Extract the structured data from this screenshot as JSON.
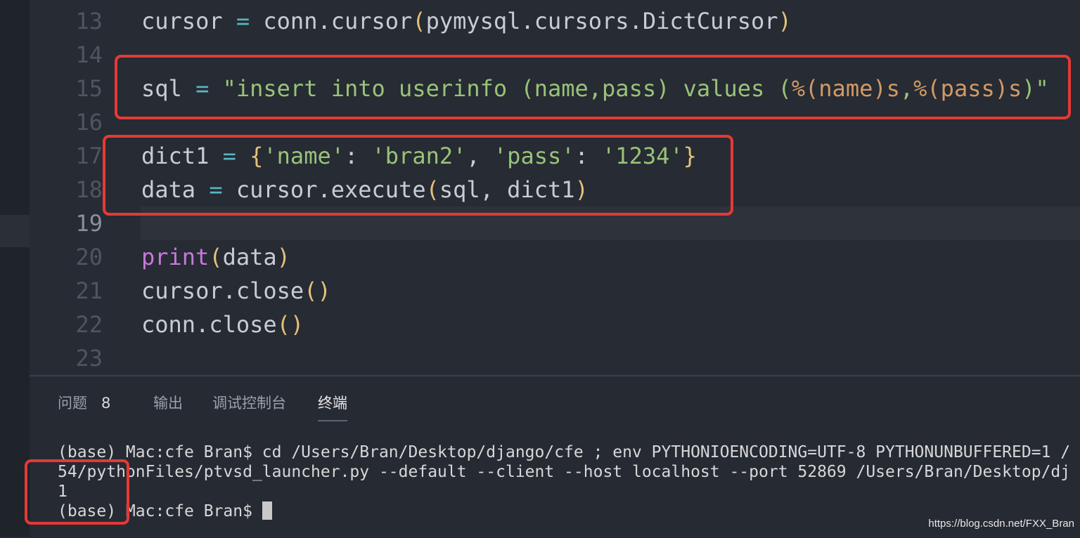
{
  "editor": {
    "lines": [
      {
        "number": "13",
        "segments": [
          {
            "t": "cursor",
            "c": ""
          },
          {
            "t": " ",
            "c": ""
          },
          {
            "t": "=",
            "c": "op"
          },
          {
            "t": " conn.cursor",
            "c": ""
          },
          {
            "t": "(",
            "c": "br"
          },
          {
            "t": "pymysql.cursors.DictCursor",
            "c": ""
          },
          {
            "t": ")",
            "c": "br"
          }
        ]
      },
      {
        "number": "14",
        "segments": []
      },
      {
        "number": "15",
        "segments": [
          {
            "t": "sql",
            "c": ""
          },
          {
            "t": " ",
            "c": ""
          },
          {
            "t": "=",
            "c": "op"
          },
          {
            "t": " ",
            "c": ""
          },
          {
            "t": "\"insert into userinfo ",
            "c": "str"
          },
          {
            "t": "(name,pass)",
            "c": "str"
          },
          {
            "t": " values ",
            "c": "str"
          },
          {
            "t": "(",
            "c": "str"
          },
          {
            "t": "%(name)s",
            "c": "fmt"
          },
          {
            "t": ",",
            "c": "str"
          },
          {
            "t": "%(pass)s",
            "c": "fmt"
          },
          {
            "t": ")\"",
            "c": "str"
          }
        ]
      },
      {
        "number": "16",
        "segments": []
      },
      {
        "number": "17",
        "segments": [
          {
            "t": "dict1",
            "c": ""
          },
          {
            "t": " ",
            "c": ""
          },
          {
            "t": "=",
            "c": "op"
          },
          {
            "t": " ",
            "c": ""
          },
          {
            "t": "{",
            "c": "br"
          },
          {
            "t": "'name'",
            "c": "str"
          },
          {
            "t": ": ",
            "c": ""
          },
          {
            "t": "'bran2'",
            "c": "str"
          },
          {
            "t": ", ",
            "c": ""
          },
          {
            "t": "'pass'",
            "c": "str"
          },
          {
            "t": ": ",
            "c": ""
          },
          {
            "t": "'1234'",
            "c": "str"
          },
          {
            "t": "}",
            "c": "br"
          }
        ]
      },
      {
        "number": "18",
        "segments": [
          {
            "t": "data",
            "c": ""
          },
          {
            "t": " ",
            "c": ""
          },
          {
            "t": "=",
            "c": "op"
          },
          {
            "t": " cursor.execute",
            "c": ""
          },
          {
            "t": "(",
            "c": "br"
          },
          {
            "t": "sql, dict1",
            "c": ""
          },
          {
            "t": ")",
            "c": "br"
          }
        ]
      },
      {
        "number": "19",
        "segments": [],
        "active": true
      },
      {
        "number": "20",
        "segments": [
          {
            "t": "print",
            "c": "fn"
          },
          {
            "t": "(",
            "c": "br"
          },
          {
            "t": "data",
            "c": ""
          },
          {
            "t": ")",
            "c": "br"
          }
        ]
      },
      {
        "number": "21",
        "segments": [
          {
            "t": "cursor.close",
            "c": ""
          },
          {
            "t": "(",
            "c": "br"
          },
          {
            "t": ")",
            "c": "br"
          }
        ]
      },
      {
        "number": "22",
        "segments": [
          {
            "t": "conn.close",
            "c": ""
          },
          {
            "t": "(",
            "c": "br"
          },
          {
            "t": ")",
            "c": "br"
          }
        ]
      },
      {
        "number": "23",
        "segments": []
      }
    ]
  },
  "panel": {
    "tabs": [
      {
        "label": "问题",
        "badge": "8",
        "active": false
      },
      {
        "label": "输出",
        "active": false
      },
      {
        "label": "调试控制台",
        "active": false
      },
      {
        "label": "终端",
        "active": true
      }
    ],
    "terminal_lines": [
      "(base) Mac:cfe Bran$ cd /Users/Bran/Desktop/django/cfe ; env PYTHONIOENCODING=UTF-8 PYTHONUNBUFFERED=1 /",
      "54/pythonFiles/ptvsd_launcher.py --default --client --host localhost --port 52869 /Users/Bran/Desktop/dj",
      "1",
      "(base) Mac:cfe Bran$ "
    ]
  },
  "watermark": "https://blog.csdn.net/FXX_Bran",
  "colors": {
    "annotation": "#e53935",
    "string": "#98c379",
    "operator": "#56b6c2",
    "bracket": "#e5c07b",
    "function": "#c678dd"
  }
}
